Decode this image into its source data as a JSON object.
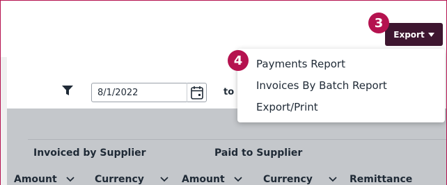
{
  "toolbar": {
    "export_label": "Export",
    "export_menu": [
      "Payments Report",
      "Invoices By Batch Report",
      "Export/Print"
    ]
  },
  "callouts": {
    "step_3": "3",
    "step_4": "4"
  },
  "filter": {
    "start_date": "8/1/2022",
    "to_label": "to"
  },
  "grid": {
    "groups": [
      "Invoiced by Supplier",
      "Paid to Supplier"
    ],
    "columns": [
      "Amount",
      "Currency",
      "Amount",
      "Currency",
      "Remittance"
    ]
  },
  "colors": {
    "accent": "#b5124f",
    "export_button": "#3e1630",
    "header_bg": "#c4c7cb"
  },
  "icons": [
    "filter-icon",
    "calendar-icon",
    "chevron-down-icon",
    "caret-down-icon"
  ]
}
